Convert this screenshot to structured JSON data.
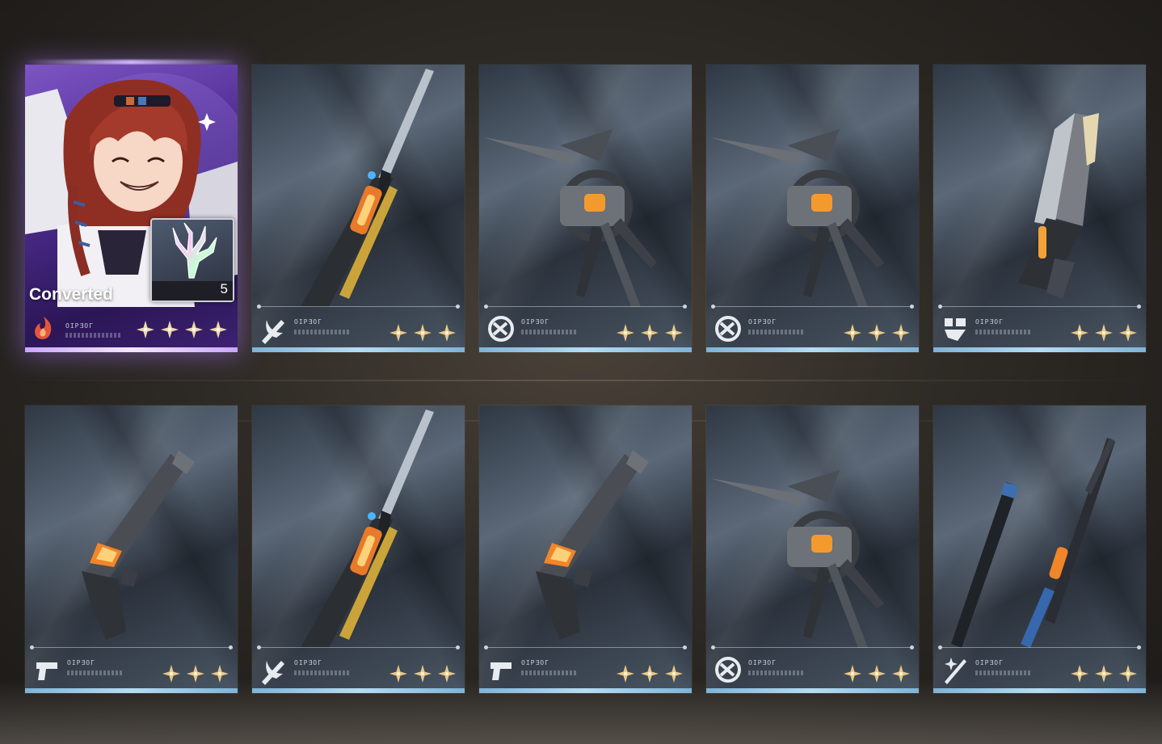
{
  "character_card": {
    "status_label": "Converted",
    "item_count": "5",
    "rarity_stars": 4,
    "element_icon": "fusion-flame-icon",
    "item_icon": "coral-crystal-icon"
  },
  "cards": [
    {
      "weapon": "broadblade",
      "type_icon": "broadblade-icon",
      "code": "OIPƎOГ",
      "stars": 3
    },
    {
      "weapon": "gauntlets",
      "type_icon": "gauntlets-icon",
      "code": "OIPƎOГ",
      "stars": 3
    },
    {
      "weapon": "gauntlets",
      "type_icon": "gauntlets-icon",
      "code": "OIPƎOГ",
      "stars": 3
    },
    {
      "weapon": "rectifier",
      "type_icon": "rectifier-icon",
      "code": "OIPƎOГ",
      "stars": 3
    },
    {
      "weapon": "pistols",
      "type_icon": "pistols-icon",
      "code": "OIPƎOГ",
      "stars": 3
    },
    {
      "weapon": "broadblade",
      "type_icon": "broadblade-icon",
      "code": "OIPƎOГ",
      "stars": 3
    },
    {
      "weapon": "pistols",
      "type_icon": "pistols-icon",
      "code": "OIPƎOГ",
      "stars": 3
    },
    {
      "weapon": "gauntlets",
      "type_icon": "gauntlets-icon",
      "code": "OIPƎOГ",
      "stars": 3
    },
    {
      "weapon": "sword",
      "type_icon": "sword-icon",
      "code": "OIPƎOГ",
      "stars": 3
    }
  ],
  "colors": {
    "card_underbar": "#9ccbe8",
    "char_underbar": "#e6d4ff",
    "star_gold": "#e9c987"
  }
}
